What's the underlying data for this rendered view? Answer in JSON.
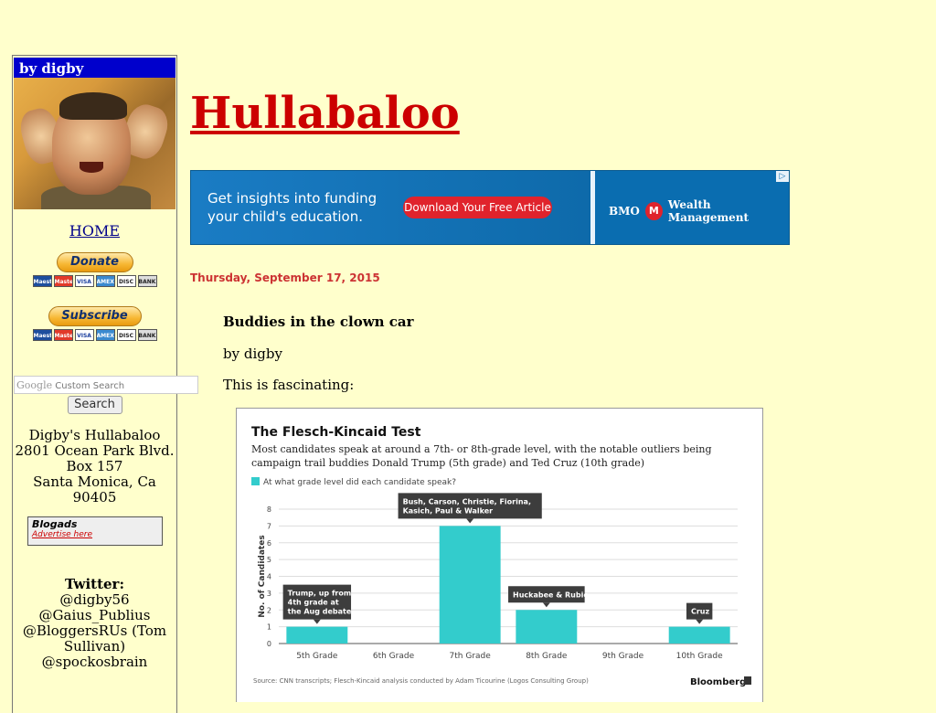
{
  "sidebar": {
    "header": "by digby",
    "home_link": "HOME",
    "donate_label": "Donate",
    "subscribe_label": "Subscribe",
    "card_labels": [
      "Maestro",
      "Master",
      "VISA",
      "AMEX",
      "DISC",
      "BANK"
    ],
    "search_placeholder": "Custom Search",
    "search_brand": "Google",
    "search_button": "Search",
    "address": [
      "Digby's Hullabaloo",
      "2801 Ocean Park Blvd.",
      "Box 157",
      "Santa Monica, Ca 90405"
    ],
    "blogads": {
      "title": "Blogads",
      "link": "Advertise here"
    },
    "twitter": {
      "heading": "Twitter:",
      "handles": [
        "@digby56",
        "@Gaius_Publius",
        "@BloggersRUs (Tom",
        "Sullivan)",
        "@spockosbrain"
      ]
    }
  },
  "blog_title": "Hullabaloo",
  "ad": {
    "line1": "Get insights into funding",
    "line2": "your child's education.",
    "cta": "Download Your Free Article",
    "brand": "BMO",
    "brand_rest": "Wealth Management",
    "logo_glyph": "M"
  },
  "post": {
    "date": "Thursday, September 17, 2015",
    "title": "Buddies in the clown car",
    "byline": "by digby",
    "intro": "This is fascinating:"
  },
  "chart_data": {
    "type": "bar",
    "title": "The Flesch-Kincaid Test",
    "subtitle_lines": [
      "Most candidates speak at around a 7th- or 8th-grade level, with the notable outliers being",
      "campaign trail buddies Donald Trump (5th grade) and Ted Cruz (10th grade)"
    ],
    "legend": "At what grade level did each candidate speak?",
    "categories": [
      "5th Grade",
      "6th Grade",
      "7th Grade",
      "8th Grade",
      "9th Grade",
      "10th Grade"
    ],
    "values": [
      1,
      0,
      7,
      2,
      0,
      1
    ],
    "ylabel": "No. of Candidates",
    "ylim": [
      0,
      8
    ],
    "yticks": [
      0,
      1,
      2,
      3,
      4,
      5,
      6,
      7,
      8
    ],
    "annotations": [
      {
        "category_index": 0,
        "lines": [
          "Trump, up from",
          "4th grade at",
          "the Aug debate"
        ]
      },
      {
        "category_index": 2,
        "lines": [
          "Bush, Carson, Christie, Fiorina,",
          "Kasich, Paul & Walker"
        ]
      },
      {
        "category_index": 3,
        "lines": [
          "Huckabee & Rubio"
        ]
      },
      {
        "category_index": 5,
        "lines": [
          "Cruz"
        ]
      }
    ],
    "source": "Source: CNN transcripts; Flesch-Kincaid analysis conducted by Adam Ticourine (Logos Consulting Group)",
    "brand": "Bloomberg",
    "bar_color": "#33cccc",
    "grid": true
  }
}
